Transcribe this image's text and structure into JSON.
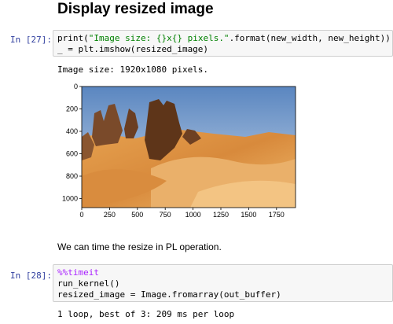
{
  "heading": "Display resized image",
  "cell27": {
    "prompt": "In [27]:",
    "line1_a": "print(",
    "line1_string": "\"Image size: {}x{} pixels.\"",
    "line1_b": ".format(new_width, new_height))",
    "line2": "_ = plt.imshow(resized_image)",
    "output": "Image size: 1920x1080 pixels."
  },
  "plot": {
    "y_ticks": [
      "0",
      "200",
      "400",
      "600",
      "800",
      "1000"
    ],
    "x_ticks": [
      "0",
      "250",
      "500",
      "750",
      "1000",
      "1250",
      "1500",
      "1750"
    ],
    "image_subject": "desert-rock-formations-photo"
  },
  "markdown": "We can time the resize in PL operation.",
  "cell28": {
    "prompt": "In [28]:",
    "line1": "%%timeit",
    "line2": "run_kernel()",
    "line3": "resized_image = Image.fromarray(out_buffer)",
    "output": "1 loop, best of 3: 209 ms per loop"
  },
  "colors": {
    "prompt": "#303f9f",
    "string": "#008000",
    "code_bg": "#f7f7f7",
    "cell_border": "#cfcfcf"
  }
}
